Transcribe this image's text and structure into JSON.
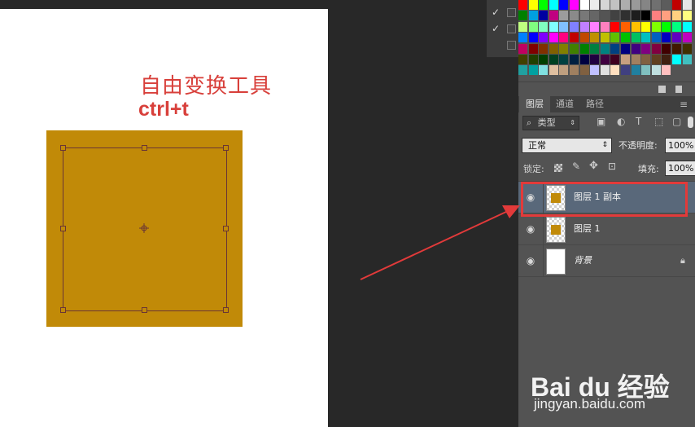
{
  "annotation": {
    "title": "自由变换工具",
    "shortcut": "ctrl+t"
  },
  "colors": {
    "shape_fill": "#c18a08",
    "annotation": "#d8403b",
    "highlight": "#e23a3a"
  },
  "swatches": [
    "#ff0000",
    "#ffff00",
    "#00ff00",
    "#00ffff",
    "#0000ff",
    "#ff00ff",
    "#ffffff",
    "#ebebeb",
    "#d6d6d6",
    "#c2c2c2",
    "#adadad",
    "#999999",
    "#858585",
    "#707070",
    "#5c5c5c",
    "#c00000",
    "#e6e6e6",
    "#008000",
    "#00a0e0",
    "#0000a0",
    "#c00080",
    "#9c9c9c",
    "#8a8a8a",
    "#787878",
    "#666666",
    "#545454",
    "#424242",
    "#303030",
    "#1e1e1e",
    "#000000",
    "#ff8080",
    "#ffa080",
    "#ffd080",
    "#ffff80",
    "#c0ff80",
    "#80ff80",
    "#80ffc0",
    "#80ffff",
    "#80c0ff",
    "#8080ff",
    "#c080ff",
    "#ff80ff",
    "#ff80c0",
    "#ff0000",
    "#ff6000",
    "#ffc000",
    "#ffff00",
    "#80ff00",
    "#00ff00",
    "#00ff80",
    "#00ffff",
    "#0080ff",
    "#0000ff",
    "#8000ff",
    "#ff00ff",
    "#ff0080",
    "#c00000",
    "#c04800",
    "#c09000",
    "#c0c000",
    "#60c000",
    "#00c000",
    "#00c060",
    "#00c0c0",
    "#0060c0",
    "#0000c0",
    "#6000c0",
    "#c000c0",
    "#c00060",
    "#800000",
    "#803000",
    "#806000",
    "#808000",
    "#408000",
    "#008000",
    "#008040",
    "#008080",
    "#004080",
    "#000080",
    "#400080",
    "#800080",
    "#800040",
    "#400000",
    "#401800",
    "#403000",
    "#404000",
    "#204000",
    "#004000",
    "#004020",
    "#004040",
    "#002040",
    "#000040",
    "#200040",
    "#400040",
    "#400020",
    "#c8a080",
    "#a08060",
    "#806040",
    "#604020",
    "#402010",
    "#00ffff",
    "#40c0c0",
    "#20a0a0",
    "#00a0a0",
    "#80e0e0",
    "#e0c0a0",
    "#c0a080",
    "#a08060",
    "#806040",
    "#c0c0ff",
    "#e0e0e0",
    "#ffe0c0",
    "#404080",
    "#2080a0",
    "#80c0c0",
    "#c0e0e0",
    "#ffc0c0"
  ],
  "tabs": [
    "图层",
    "通道",
    "路径"
  ],
  "filter": {
    "label": "类型"
  },
  "blend_mode": "正常",
  "opacity": {
    "label": "不透明度:",
    "value": "100%"
  },
  "lock": {
    "label": "锁定:"
  },
  "fill": {
    "label": "填充:",
    "value": "100%"
  },
  "layers": [
    {
      "name": "图层 1 副本",
      "selected": true
    },
    {
      "name": "图层 1",
      "selected": false
    },
    {
      "name": "背景",
      "locked": true
    }
  ],
  "watermark": {
    "brand": "Bai du 经验",
    "url": "jingyan.baidu.com"
  }
}
